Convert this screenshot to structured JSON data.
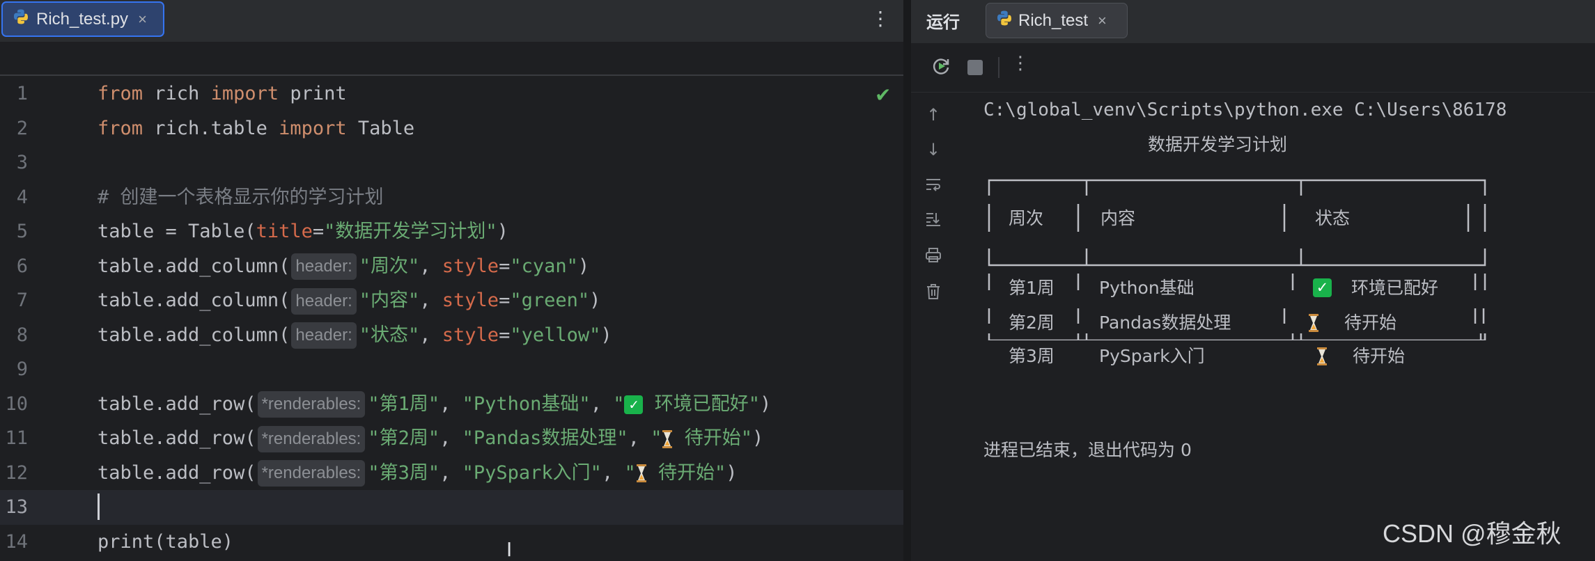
{
  "editor": {
    "tab": {
      "label": "Rich_test.py",
      "close": "×",
      "icon": "python-file-icon"
    },
    "more": "⋮",
    "status_icon": "check-icon",
    "lines": [
      {
        "n": "1"
      },
      {
        "n": "2"
      },
      {
        "n": "3"
      },
      {
        "n": "4"
      },
      {
        "n": "5"
      },
      {
        "n": "6"
      },
      {
        "n": "7"
      },
      {
        "n": "8"
      },
      {
        "n": "9"
      },
      {
        "n": "10"
      },
      {
        "n": "11"
      },
      {
        "n": "12"
      },
      {
        "n": "13"
      },
      {
        "n": "14"
      }
    ],
    "code": {
      "l1": {
        "a": "from",
        "b": " rich ",
        "c": "import",
        "d": " print"
      },
      "l2": {
        "a": "from",
        "b": " rich.table ",
        "c": "import",
        "d": " Table"
      },
      "l4": "# 创建一个表格显示你的学习计划",
      "l5": {
        "a": "table = Table(",
        "b": "title",
        "c": "=",
        "d": "\"数据开发学习计划\"",
        "e": ")"
      },
      "l6": {
        "a": "table.add_column(",
        "hint": "header:",
        "b": "\"周次\"",
        "c": ", ",
        "d": "style",
        "e": "=",
        "f": "\"cyan\"",
        "g": ")"
      },
      "l7": {
        "a": "table.add_column(",
        "hint": "header:",
        "b": "\"内容\"",
        "c": ", ",
        "d": "style",
        "e": "=",
        "f": "\"green\"",
        "g": ")"
      },
      "l8": {
        "a": "table.add_column(",
        "hint": "header:",
        "b": "\"状态\"",
        "c": ", ",
        "d": "style",
        "e": "=",
        "f": "\"yellow\"",
        "g": ")"
      },
      "l10": {
        "a": "table.add_row(",
        "hint": "*renderables:",
        "b": "\"第1周\"",
        "c": ", ",
        "d": "\"Python基础\"",
        "e": ", ",
        "f": "\"",
        "g": " 环境已配好\"",
        "h": ")"
      },
      "l11": {
        "a": "table.add_row(",
        "hint": "*renderables:",
        "b": "\"第2周\"",
        "c": ", ",
        "d": "\"Pandas数据处理\"",
        "e": ", ",
        "f": "\"",
        "g": " 待开始\"",
        "h": ")"
      },
      "l12": {
        "a": "table.add_row(",
        "hint": "*renderables:",
        "b": "\"第3周\"",
        "c": ", ",
        "d": "\"PySpark入门\"",
        "e": ", ",
        "f": "\"",
        "g": " 待开始\"",
        "h": ")"
      },
      "l14": "print(table)"
    }
  },
  "run": {
    "title": "运行",
    "tab": {
      "label": "Rich_test",
      "close": "×",
      "icon": "python-run-icon"
    },
    "toolbar": {
      "rerun": "rerun-icon",
      "stop": "stop-icon",
      "more": "⋮"
    },
    "side": [
      "up-arrow-icon",
      "down-arrow-icon",
      "soft-wrap-icon",
      "scroll-to-end-icon",
      "print-icon",
      "trash-icon"
    ],
    "console": {
      "command": "C:\\global_venv\\Scripts\\python.exe C:\\Users\\86178",
      "table_title": "数据开发学习计划",
      "headers": [
        "周次",
        "内容",
        "状态"
      ],
      "rows": [
        {
          "week": "第1周",
          "content": "Python基础",
          "status": "环境已配好",
          "status_icon": "check-mark-icon"
        },
        {
          "week": "第2周",
          "content": "Pandas数据处理",
          "status": "待开始",
          "status_icon": "hourglass-icon"
        },
        {
          "week": "第3周",
          "content": "PySpark入门",
          "status": "待开始",
          "status_icon": "hourglass-icon"
        }
      ],
      "exit_message": "进程已结束，退出代码为 0"
    }
  },
  "watermark": "CSDN @穆金秋",
  "colors": {
    "keyword": "#cf8e6d",
    "string": "#6aab73",
    "param": "#d56a4b",
    "comment": "#7a7e85",
    "accent": "#3574f0",
    "check": "#19b24b"
  }
}
